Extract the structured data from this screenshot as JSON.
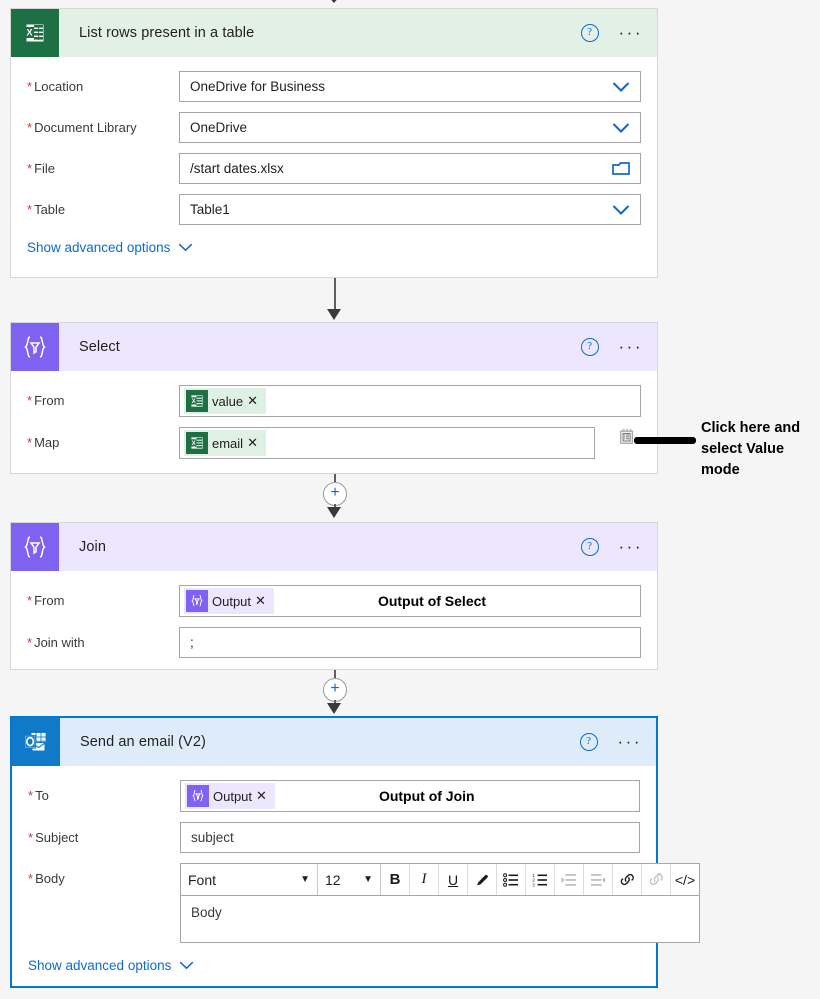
{
  "flow": {
    "cards": [
      {
        "id": "list-rows",
        "title": "List rows present in a table",
        "icon": "excel-icon",
        "help_label": "?",
        "more_label": "···",
        "advanced_label": "Show advanced options",
        "fields": [
          {
            "label": "Location",
            "value": "OneDrive for Business",
            "control": "dropdown"
          },
          {
            "label": "Document Library",
            "value": "OneDrive",
            "control": "dropdown"
          },
          {
            "label": "File",
            "value": "/start dates.xlsx",
            "control": "file-picker"
          },
          {
            "label": "Table",
            "value": "Table1",
            "control": "dropdown"
          }
        ]
      },
      {
        "id": "select",
        "title": "Select",
        "icon": "data-operation-icon",
        "help_label": "?",
        "more_label": "···",
        "fields": [
          {
            "label": "From",
            "token": "value",
            "token_icon": "excel-icon",
            "close_label": "✕"
          },
          {
            "label": "Map",
            "token": "email",
            "token_icon": "excel-icon",
            "close_label": "✕"
          }
        ]
      },
      {
        "id": "join",
        "title": "Join",
        "icon": "data-operation-icon",
        "help_label": "?",
        "more_label": "···",
        "fields": [
          {
            "label": "From",
            "token": "Output",
            "token_icon": "data-operation-icon",
            "close_label": "✕",
            "caption": "Output of Select"
          },
          {
            "label": "Join with",
            "value": ";"
          }
        ]
      },
      {
        "id": "send-email",
        "title": "Send an email (V2)",
        "icon": "outlook-icon",
        "help_label": "?",
        "more_label": "···",
        "advanced_label": "Show advanced options",
        "fields": [
          {
            "label": "To",
            "token": "Output",
            "token_icon": "data-operation-icon",
            "close_label": "✕",
            "caption": "Output of Join"
          },
          {
            "label": "Subject",
            "value": "subject"
          },
          {
            "label": "Body",
            "value": "Body"
          }
        ]
      }
    ],
    "rte_toolbar": {
      "font_label": "Font",
      "size_label": "12",
      "buttons": [
        {
          "name": "bold-icon",
          "glyph": "B",
          "enabled": true
        },
        {
          "name": "italic-icon",
          "glyph": "I",
          "enabled": true
        },
        {
          "name": "underline-icon",
          "glyph": "U",
          "enabled": true
        },
        {
          "name": "highlighter-icon",
          "glyph": "✐",
          "enabled": true
        },
        {
          "name": "bulleted-list-icon",
          "glyph": "",
          "enabled": true
        },
        {
          "name": "numbered-list-icon",
          "glyph": "",
          "enabled": true
        },
        {
          "name": "indent-icon",
          "glyph": "",
          "enabled": false
        },
        {
          "name": "outdent-icon",
          "glyph": "",
          "enabled": false
        },
        {
          "name": "link-icon",
          "glyph": "",
          "enabled": true
        },
        {
          "name": "unlink-icon",
          "glyph": "",
          "enabled": false
        },
        {
          "name": "code-view-icon",
          "glyph": "</>",
          "enabled": true
        }
      ]
    },
    "add_step_label": "+",
    "annotation": {
      "line1": "Click here and",
      "line2": "select Value mode"
    },
    "colors": {
      "excel_green": "#1d7044",
      "excel_header": "#e3f0e6",
      "purple": "#8062f2",
      "purple_header": "#ece6fe",
      "outlook_blue": "#0f7ac8",
      "outlook_header": "#deecf9",
      "selection": "#0078d4",
      "link": "#0b6ccd",
      "required": "#d13438",
      "canvas": "#f5f5f5"
    }
  }
}
